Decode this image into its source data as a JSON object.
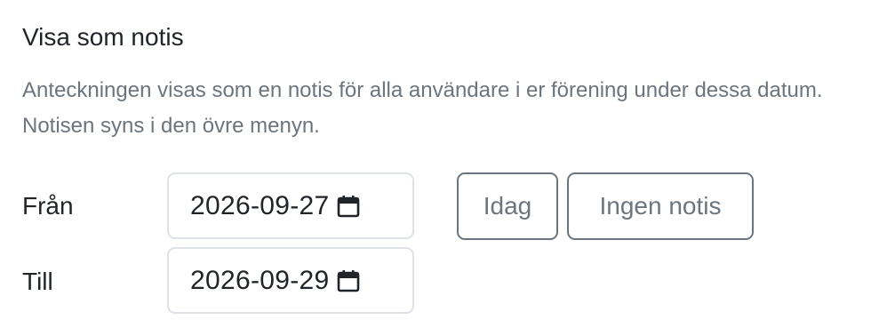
{
  "section": {
    "title": "Visa som notis",
    "description": "Anteckningen visas som en notis för alla användare i er förening under dessa datum. Notisen syns i den övre menyn."
  },
  "fields": {
    "from": {
      "label": "Från",
      "value": "2026-09-27",
      "icon": "calendar-icon"
    },
    "to": {
      "label": "Till",
      "value": "2026-09-29",
      "icon": "calendar-icon"
    }
  },
  "buttons": {
    "today_label": "Idag",
    "no_notice_label": "Ingen notis"
  },
  "colors": {
    "text": "#212529",
    "muted": "#6c757d",
    "input_border": "#dee2e6",
    "button_border": "#6c757d",
    "background": "#ffffff"
  }
}
